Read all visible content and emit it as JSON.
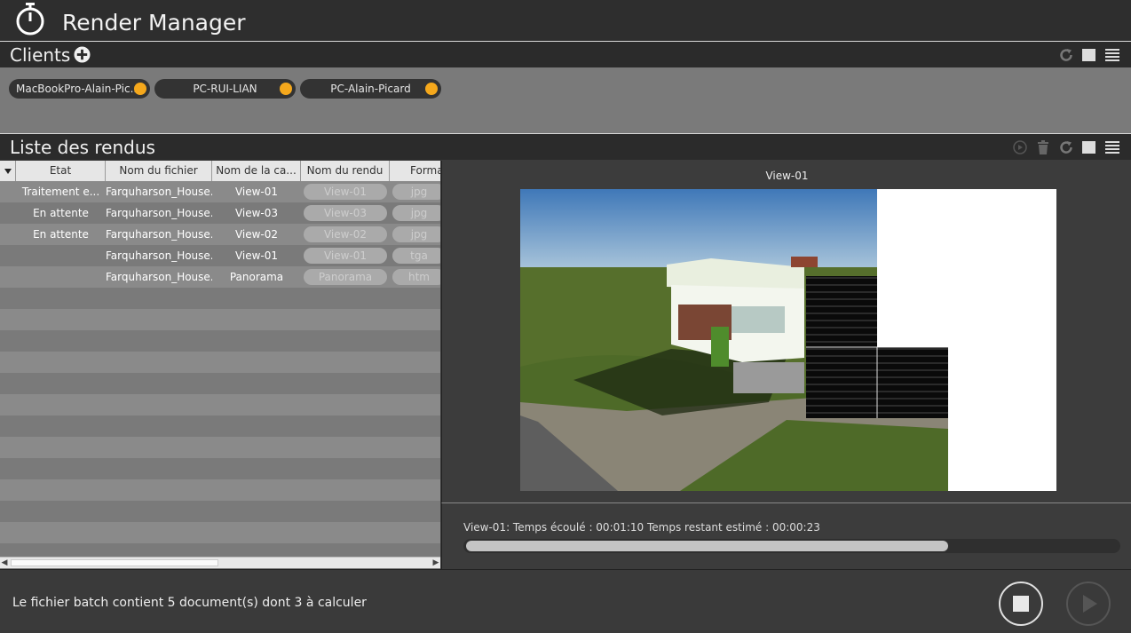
{
  "app": {
    "title": "Render Manager"
  },
  "clients": {
    "title": "Clients",
    "items": [
      {
        "label": "MacBookPro-Alain-Pic..."
      },
      {
        "label": "PC-RUI-LIAN"
      },
      {
        "label": "PC-Alain-Picard"
      }
    ],
    "status_color": "#f5a81c"
  },
  "renders": {
    "title": "Liste des rendus",
    "columns": [
      "Etat",
      "Nom du fichier",
      "Nom de la ca...",
      "Nom du rendu",
      "Forma"
    ],
    "rows": [
      {
        "etat": "Traitement e...",
        "fichier": "Farquharson_House...",
        "camera": "View-01",
        "rendu": "View-01",
        "format": "jpg"
      },
      {
        "etat": "En attente",
        "fichier": "Farquharson_House...",
        "camera": "View-03",
        "rendu": "View-03",
        "format": "jpg"
      },
      {
        "etat": "En attente",
        "fichier": "Farquharson_House...",
        "camera": "View-02",
        "rendu": "View-02",
        "format": "jpg"
      },
      {
        "etat": "",
        "fichier": "Farquharson_House...",
        "camera": "View-01",
        "rendu": "View-01",
        "format": "tga"
      },
      {
        "etat": "",
        "fichier": "Farquharson_House...",
        "camera": "Panorama",
        "rendu": "Panorama",
        "format": "htm"
      }
    ]
  },
  "preview": {
    "title": "View-01",
    "progress_text": "View-01: Temps écoulé : 00:01:10 Temps restant estimé : 00:00:23",
    "progress_fraction": 0.74
  },
  "footer": {
    "status": "Le fichier batch contient 5 document(s) dont 3 à calculer"
  }
}
